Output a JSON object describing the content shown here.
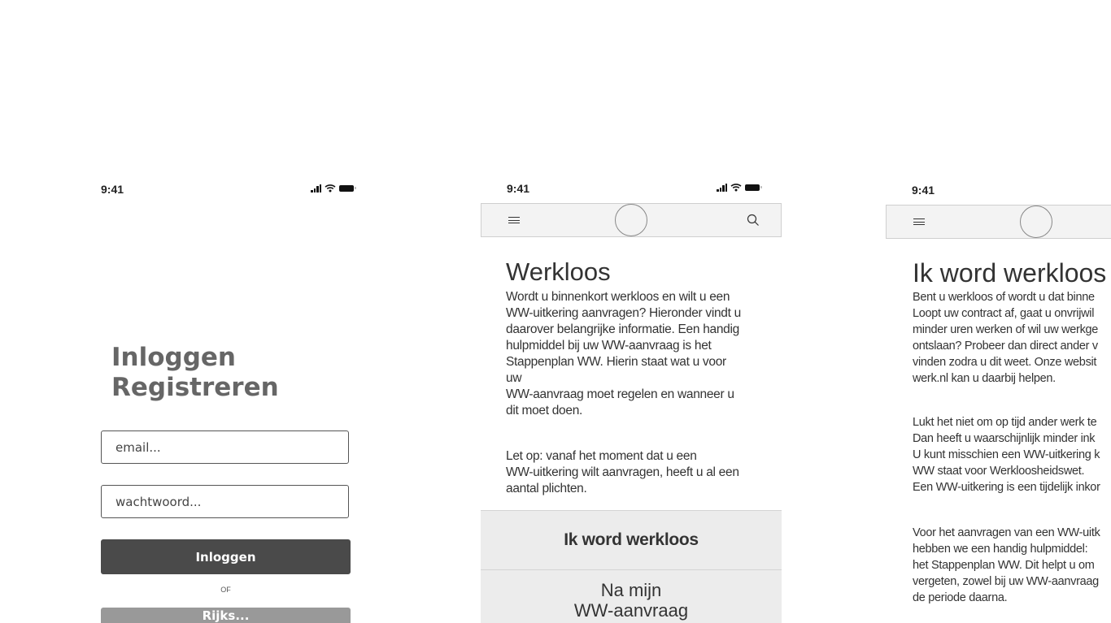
{
  "login_screen": {
    "status_time": "9:41",
    "heading_line1": "Inloggen",
    "heading_line2": "Registreren",
    "email_placeholder": "email...",
    "password_placeholder": "wachtwoord...",
    "login_button": "Inloggen",
    "or_text": "OF",
    "secondary_button": "Rijks..."
  },
  "info_screen": {
    "status_time": "9:41",
    "nav": {
      "menu_icon": "hamburger-icon",
      "logo": "logo-placeholder",
      "search_icon": "search-icon"
    },
    "title": "Werkloos",
    "intro": "Wordt u binnenkort werkloos en wilt u een\nWW-uitkering aanvragen? Hieronder vindt u\ndaarover belangrijke informatie. Een handig\nhulpmiddel bij uw WW-aanvraag is het\nStappenplan WW. Hierin staat wat u voor\nuw\nWW-aanvraag moet regelen en wanneer u\ndit moet doen.",
    "note": "Let op: vanaf het moment dat u een\nWW-uitkering wilt aanvragen, heeft u al een\naantal plichten.",
    "menu_items": [
      {
        "label": "Ik word werkloos"
      },
      {
        "label": "Na mijn\nWW-aanvraag"
      }
    ]
  },
  "detail_screen": {
    "status_time": "9:41",
    "nav": {
      "menu_icon": "hamburger-icon",
      "logo": "logo-placeholder"
    },
    "title": "Ik word werkloos",
    "para1": "Bent u werkloos of wordt u dat binne\nLoopt uw contract af, gaat u onvrijwil\nminder uren werken of wil uw werkge\nontslaan? Probeer dan direct ander v\nvinden zodra u dit weet. Onze websit\nwerk.nl kan u daarbij helpen.",
    "para2": "Lukt het niet om op tijd ander werk te\nDan heeft u waarschijnlijk minder ink\nU kunt misschien een WW-uitkering k\nWW staat voor Werkloosheidswet.\nEen WW-uitkering is een tijdelijk inkor",
    "para3": "Voor het aanvragen van een WW-uitk\nhebben we een handig hulpmiddel:\nhet Stappenplan WW. Dit helpt u om\nvergeten, zowel bij uw WW-aanvraag\nde periode daarna."
  }
}
